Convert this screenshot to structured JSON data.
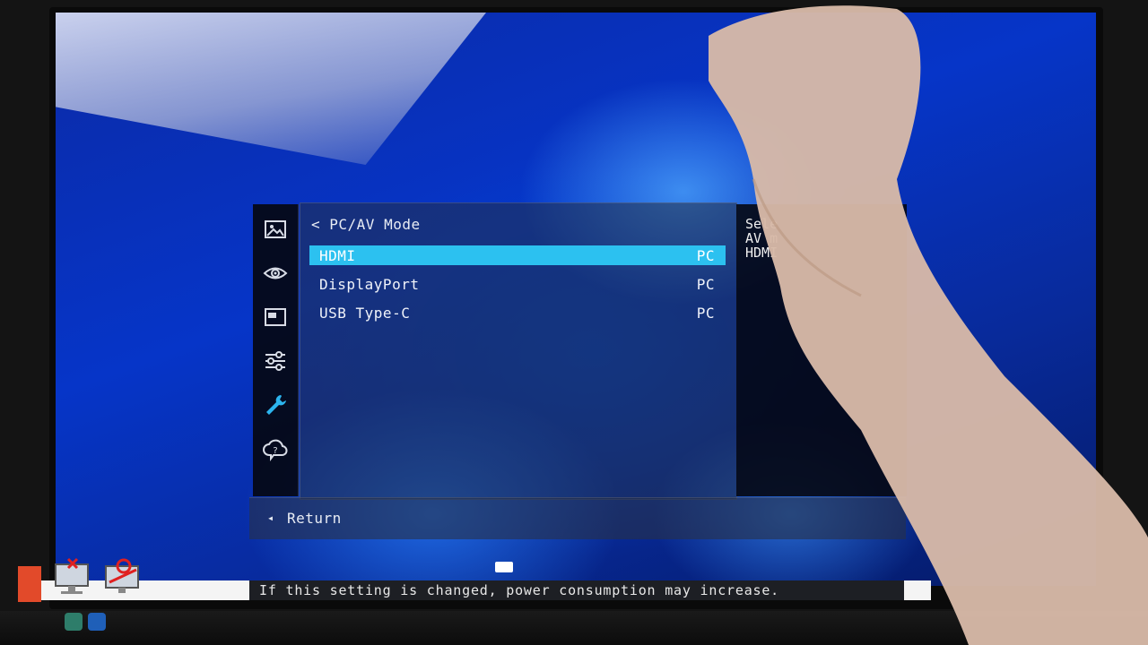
{
  "osd": {
    "title": "< PC/AV Mode",
    "rows": [
      {
        "label": "HDMI",
        "value": "PC",
        "selected": true
      },
      {
        "label": "DisplayPort",
        "value": "PC",
        "selected": false
      },
      {
        "label": "USB Type-C",
        "value": "PC",
        "selected": false
      }
    ],
    "sidebar_icons": [
      "picture-icon",
      "eye-icon",
      "window-icon",
      "sliders-icon",
      "wrench-icon",
      "help-cloud-icon"
    ],
    "help_text": [
      "Sele",
      "AV m",
      "HDMI"
    ],
    "footer": {
      "return_arrow": "◂",
      "return_label": "Return"
    }
  },
  "notice": {
    "text": "If this setting is changed, power consumption may increase."
  },
  "colors": {
    "selection": "#2cc1f0",
    "active_icon": "#2cb4ee",
    "wallpaper": "#0635c8"
  }
}
